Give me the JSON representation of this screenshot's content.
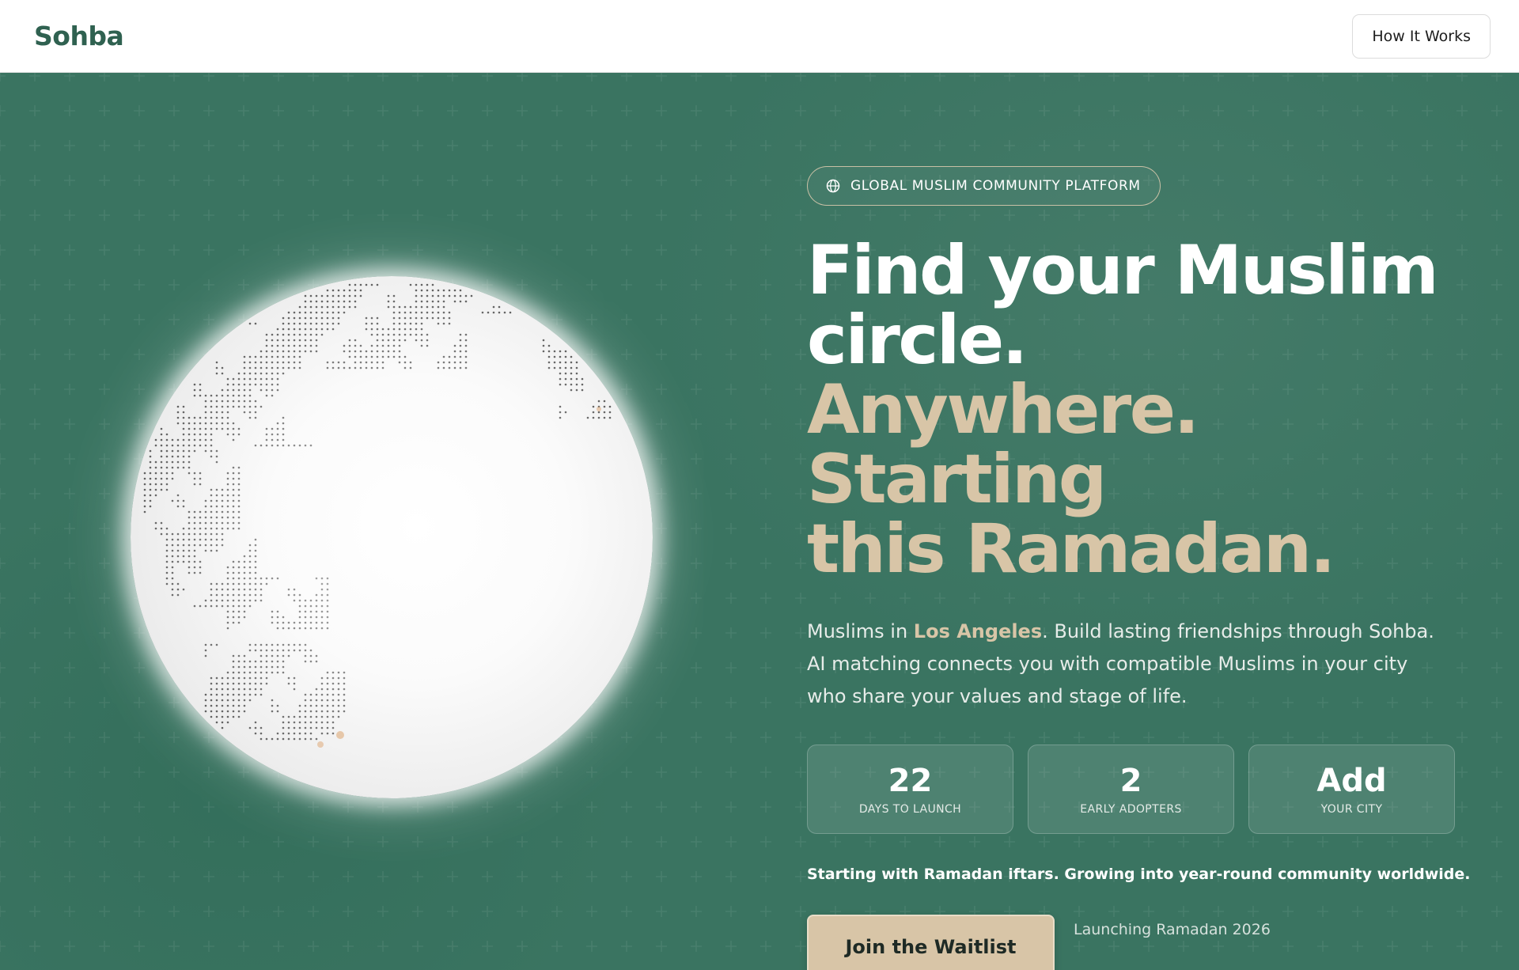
{
  "nav": {
    "logo": "Sohba",
    "how_it_works": "How It Works"
  },
  "hero": {
    "badge": {
      "icon": "globe-icon",
      "text": "GLOBAL MUSLIM COMMUNITY PLATFORM"
    },
    "headline_line1": "Find your Muslim",
    "headline_line2": "circle.",
    "headline_line3": "Anywhere. Starting",
    "headline_line4": "this Ramadan.",
    "description_prefix": "Muslims in ",
    "description_city": "Los Angeles",
    "description_rest": ". Build lasting friendships through Sohba. AI matching connects you with compatible Muslims in your city who share your values and stage of life.",
    "stats": [
      {
        "value": "22",
        "label": "DAYS TO LAUNCH"
      },
      {
        "value": "2",
        "label": "EARLY ADOPTERS"
      },
      {
        "value": "Add",
        "label": "YOUR CITY"
      }
    ],
    "tagline": "Starting with Ramadan iftars. Growing into year-round community worldwide.",
    "cta_label": "Join the Waitlist",
    "launch_note": "Launching Ramadan 2026"
  },
  "colors": {
    "brand_green": "#3a7461",
    "logo_green": "#2f6150",
    "sand_accent": "#d8c5a7"
  }
}
